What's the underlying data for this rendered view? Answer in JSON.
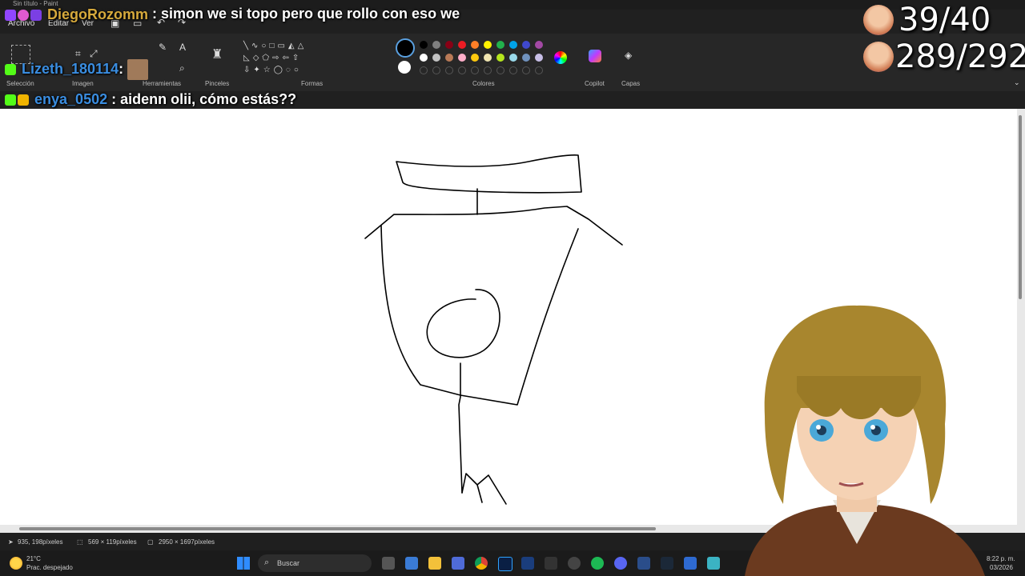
{
  "window": {
    "title": "Sin título - Paint"
  },
  "menu": {
    "file": "Archivo",
    "edit": "Editar",
    "view": "Ver"
  },
  "ribbon": {
    "selection": "Selección",
    "image": "Imagen",
    "tools": "Herramientas",
    "brushes": "Pinceles",
    "shapes": "Formas",
    "colors": "Colores",
    "copilot": "Copilot",
    "layers": "Capas"
  },
  "palette": {
    "row1": [
      "#000000",
      "#7f7f7f",
      "#880015",
      "#ed1c24",
      "#ff7f27",
      "#fff200",
      "#22b14c",
      "#00a2e8",
      "#3f48cc",
      "#a349a4"
    ],
    "row2": [
      "#ffffff",
      "#c3c3c3",
      "#b97a57",
      "#ffaec9",
      "#ffc90e",
      "#efe4b0",
      "#b5e61d",
      "#99d9ea",
      "#7092be",
      "#c8bfe7"
    ]
  },
  "chat": [
    {
      "user": "DiegoRozomm",
      "message": ": simon we si topo pero que rollo con eso we"
    },
    {
      "user": "Lizeth_180114",
      "message": ":"
    },
    {
      "user": "enya_0502",
      "message": ": aidenn olii, cómo estás??"
    }
  ],
  "counters": {
    "top": "39/40",
    "bottom": "289/292"
  },
  "status": {
    "cursor": "935, 198píxeles",
    "selection": "569 × 119píxeles",
    "canvas": "2950 × 1697píxeles"
  },
  "taskbar": {
    "weather_temp": "21°C",
    "weather_desc": "Prac. despejado",
    "search": "Buscar",
    "time": "8:22 p. m.",
    "date": "03/2026"
  }
}
